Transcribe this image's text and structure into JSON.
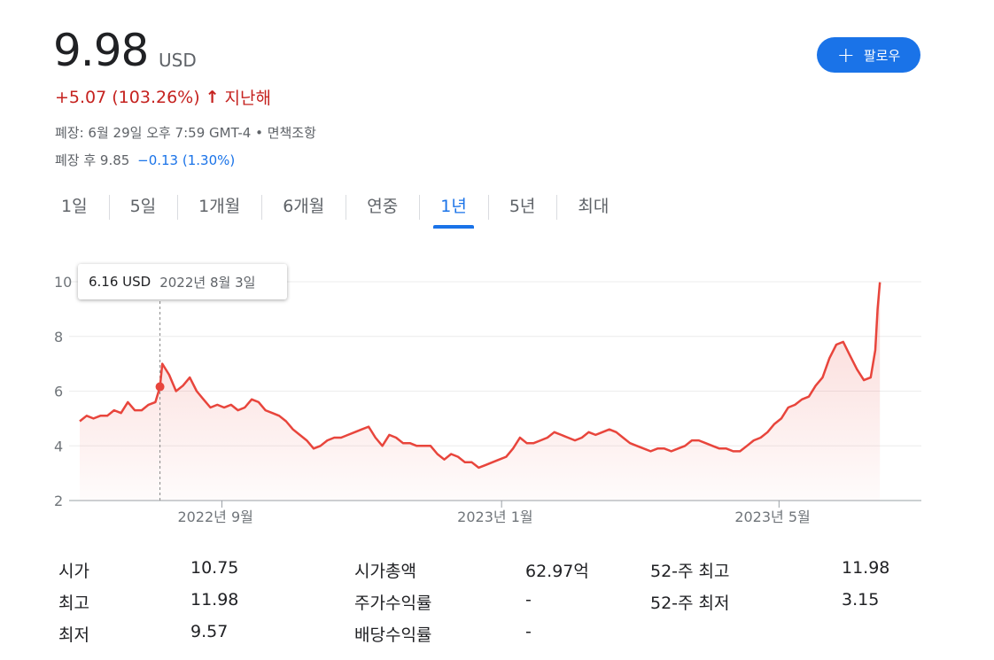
{
  "header": {
    "price": "9.98",
    "currency": "USD",
    "change": "+5.07 (103.26%)",
    "change_arrow": "↑",
    "change_period": "지난해",
    "close_info": "폐장: 6월 29일 오후 7:59 GMT-4 • 면책조항",
    "after_label": "폐장 후 9.85",
    "after_change": "−0.13 (1.30%)",
    "follow_label": "팔로우",
    "follow_icon": "plus-icon"
  },
  "tabs": [
    "1일",
    "5일",
    "1개월",
    "6개월",
    "연중",
    "1년",
    "5년",
    "최대"
  ],
  "active_tab": "1년",
  "tooltip": {
    "price": "6.16 USD",
    "date": "2022년 8월 3일"
  },
  "chart_data": {
    "type": "area",
    "title": "",
    "xlabel": "",
    "ylabel": "",
    "ylim": [
      2,
      10
    ],
    "yticks": [
      2,
      4,
      6,
      8,
      10
    ],
    "xticks": [
      {
        "label": "2022년 9월",
        "x": 62
      },
      {
        "label": "2023년 1월",
        "x": 184
      },
      {
        "label": "2023년 5월",
        "x": 305
      }
    ],
    "x_range": [
      0,
      364
    ],
    "line_color": "#e8453c",
    "series": [
      {
        "name": "",
        "points": [
          [
            0,
            4.9
          ],
          [
            3,
            5.1
          ],
          [
            6,
            5.0
          ],
          [
            9,
            5.1
          ],
          [
            12,
            5.1
          ],
          [
            15,
            5.3
          ],
          [
            18,
            5.2
          ],
          [
            21,
            5.6
          ],
          [
            24,
            5.3
          ],
          [
            27,
            5.3
          ],
          [
            30,
            5.5
          ],
          [
            33,
            5.6
          ],
          [
            35,
            6.16
          ],
          [
            36,
            7.0
          ],
          [
            39,
            6.6
          ],
          [
            42,
            6.0
          ],
          [
            45,
            6.2
          ],
          [
            48,
            6.5
          ],
          [
            51,
            6.0
          ],
          [
            54,
            5.7
          ],
          [
            57,
            5.4
          ],
          [
            60,
            5.5
          ],
          [
            63,
            5.4
          ],
          [
            66,
            5.5
          ],
          [
            69,
            5.3
          ],
          [
            72,
            5.4
          ],
          [
            75,
            5.7
          ],
          [
            78,
            5.6
          ],
          [
            81,
            5.3
          ],
          [
            84,
            5.2
          ],
          [
            87,
            5.1
          ],
          [
            90,
            4.9
          ],
          [
            93,
            4.6
          ],
          [
            96,
            4.4
          ],
          [
            99,
            4.2
          ],
          [
            102,
            3.9
          ],
          [
            105,
            4.0
          ],
          [
            108,
            4.2
          ],
          [
            111,
            4.3
          ],
          [
            114,
            4.3
          ],
          [
            117,
            4.4
          ],
          [
            120,
            4.5
          ],
          [
            123,
            4.6
          ],
          [
            126,
            4.7
          ],
          [
            129,
            4.3
          ],
          [
            132,
            4.0
          ],
          [
            135,
            4.4
          ],
          [
            138,
            4.3
          ],
          [
            141,
            4.1
          ],
          [
            144,
            4.1
          ],
          [
            147,
            4.0
          ],
          [
            150,
            4.0
          ],
          [
            153,
            4.0
          ],
          [
            156,
            3.7
          ],
          [
            159,
            3.5
          ],
          [
            162,
            3.7
          ],
          [
            165,
            3.6
          ],
          [
            168,
            3.4
          ],
          [
            171,
            3.4
          ],
          [
            174,
            3.2
          ],
          [
            177,
            3.3
          ],
          [
            180,
            3.4
          ],
          [
            183,
            3.5
          ],
          [
            186,
            3.6
          ],
          [
            189,
            3.9
          ],
          [
            192,
            4.3
          ],
          [
            195,
            4.1
          ],
          [
            198,
            4.1
          ],
          [
            201,
            4.2
          ],
          [
            204,
            4.3
          ],
          [
            207,
            4.5
          ],
          [
            210,
            4.4
          ],
          [
            213,
            4.3
          ],
          [
            216,
            4.2
          ],
          [
            219,
            4.3
          ],
          [
            222,
            4.5
          ],
          [
            225,
            4.4
          ],
          [
            228,
            4.5
          ],
          [
            231,
            4.6
          ],
          [
            234,
            4.5
          ],
          [
            237,
            4.3
          ],
          [
            240,
            4.1
          ],
          [
            243,
            4.0
          ],
          [
            246,
            3.9
          ],
          [
            249,
            3.8
          ],
          [
            252,
            3.9
          ],
          [
            255,
            3.9
          ],
          [
            258,
            3.8
          ],
          [
            261,
            3.9
          ],
          [
            264,
            4.0
          ],
          [
            267,
            4.2
          ],
          [
            270,
            4.2
          ],
          [
            273,
            4.1
          ],
          [
            276,
            4.0
          ],
          [
            279,
            3.9
          ],
          [
            282,
            3.9
          ],
          [
            285,
            3.8
          ],
          [
            288,
            3.8
          ],
          [
            291,
            4.0
          ],
          [
            294,
            4.2
          ],
          [
            297,
            4.3
          ],
          [
            300,
            4.5
          ],
          [
            303,
            4.8
          ],
          [
            306,
            5.0
          ],
          [
            309,
            5.4
          ],
          [
            312,
            5.5
          ],
          [
            315,
            5.7
          ],
          [
            318,
            5.8
          ],
          [
            321,
            6.2
          ],
          [
            324,
            6.5
          ],
          [
            327,
            7.2
          ],
          [
            330,
            7.7
          ],
          [
            333,
            7.8
          ],
          [
            336,
            7.3
          ],
          [
            339,
            6.8
          ],
          [
            342,
            6.4
          ],
          [
            345,
            6.5
          ],
          [
            347,
            7.5
          ],
          [
            348,
            9.0
          ],
          [
            349,
            9.98
          ]
        ]
      }
    ]
  },
  "stats": {
    "col1": [
      {
        "label": "시가",
        "value": "10.75"
      },
      {
        "label": "최고",
        "value": "11.98"
      },
      {
        "label": "최저",
        "value": "9.57"
      }
    ],
    "col2": [
      {
        "label": "시가총액",
        "value": "62.97억"
      },
      {
        "label": "주가수익률",
        "value": "-"
      },
      {
        "label": "배당수익률",
        "value": "-"
      }
    ],
    "col3": [
      {
        "label": "52-주 최고",
        "value": "11.98"
      },
      {
        "label": "52-주 최저",
        "value": "3.15"
      }
    ]
  }
}
